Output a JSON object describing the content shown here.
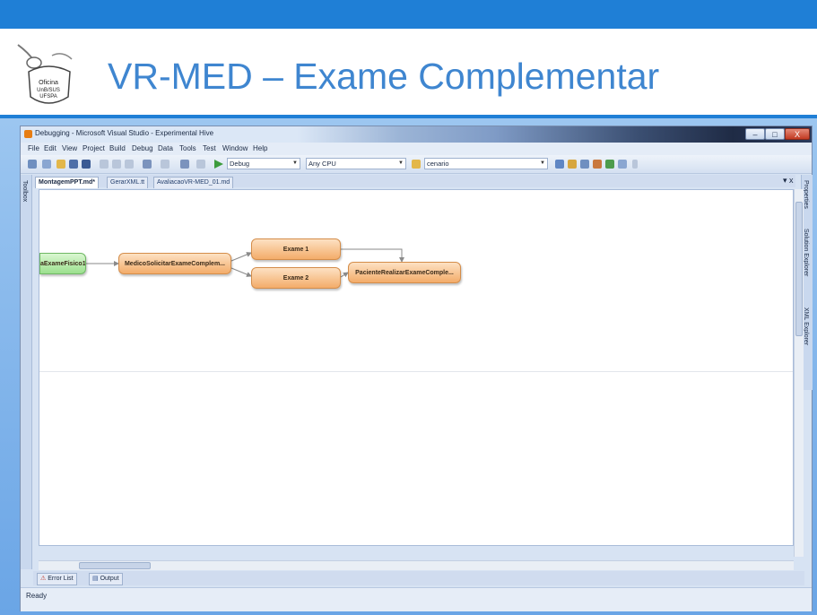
{
  "slide": {
    "title": "VR-MED – Exame Complementar",
    "logo_text": [
      "Oficina",
      "UnB/SUS",
      "UFSPA"
    ]
  },
  "window": {
    "title": "Debugging - Microsoft Visual Studio - Experimental Hive",
    "controls": {
      "minimize": "–",
      "maximize": "□",
      "close": "X"
    }
  },
  "menu": [
    "File",
    "Edit",
    "View",
    "Project",
    "Build",
    "Debug",
    "Data",
    "Tools",
    "Test",
    "Window",
    "Help"
  ],
  "toolbar": {
    "config": "Debug",
    "platform": "Any CPU",
    "find": "cenario"
  },
  "tabs": [
    {
      "label": "MontagemPPT.md*",
      "active": true
    },
    {
      "label": "GerarXML.tt",
      "active": false
    },
    {
      "label": "AvaliacaoVR-MED_01.md",
      "active": false
    }
  ],
  "tab_controls": "▾ x",
  "side_panels": {
    "left": "Toolbox",
    "right": [
      "Properties",
      "Solution Explorer",
      "XML Explorer"
    ]
  },
  "diagram": {
    "nodes": {
      "start": "aExameFisico1",
      "solicitar": "MedicoSolicitarExameComplem...",
      "exame1": "Exame 1",
      "exame2": "Exame 2",
      "realizar": "PacienteRealizarExameComple..."
    }
  },
  "bottom_tabs": [
    "Error List",
    "Output"
  ],
  "status": "Ready",
  "colors": {
    "slide_blue": "#1f7fd6",
    "title_text": "#3f86d0",
    "node_orange": "#f3ac6a",
    "node_green": "#9ce08e"
  }
}
